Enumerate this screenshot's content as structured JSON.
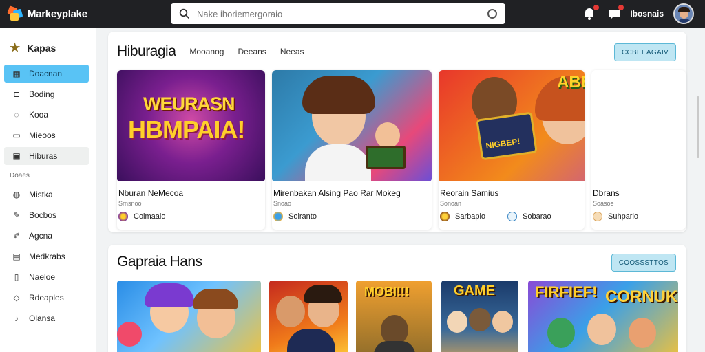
{
  "app": {
    "name": "Markeyplake"
  },
  "search": {
    "placeholder": "Nake ihoriemergoraio"
  },
  "user": {
    "name": "Ibosnais"
  },
  "sidebar": {
    "header": "Kapas",
    "items": [
      {
        "label": "Doacnan",
        "icon": "grid-icon",
        "state": "active"
      },
      {
        "label": "Boding",
        "icon": "bookmark-icon"
      },
      {
        "label": "Kooa",
        "icon": "chat-icon"
      },
      {
        "label": "Mieoos",
        "icon": "monitor-icon"
      },
      {
        "label": "Hiburas",
        "icon": "gamepad-icon",
        "state": "highlight"
      }
    ],
    "section_label": "Doaes",
    "section_items": [
      {
        "label": "Mistka",
        "icon": "headset-icon"
      },
      {
        "label": "Bocbos",
        "icon": "pencil-icon"
      },
      {
        "label": "Agcna",
        "icon": "pen-icon"
      },
      {
        "label": "Medkrabs",
        "icon": "message-icon"
      },
      {
        "label": "Naeloe",
        "icon": "document-icon"
      },
      {
        "label": "Rdeaples",
        "icon": "tag-icon"
      },
      {
        "label": "Olansa",
        "icon": "music-icon"
      }
    ]
  },
  "section1": {
    "title": "Hiburagia",
    "tabs": [
      "Mooanog",
      "Deeans",
      "Neeas"
    ],
    "button": "CCBEEAGAIV",
    "cards": [
      {
        "title": "Nburan NeMecoa",
        "subtitle": "Srnsnoo",
        "developer": "Colmaalo",
        "thumb_line1": "WEURASN",
        "thumb_line2": "HBMPAIA!"
      },
      {
        "title": "Mirenbakan Alsing Pao Rar Mokeg",
        "subtitle": "Snoao",
        "developer": "Solranto"
      },
      {
        "title": "Reorain Samius",
        "subtitle": "Sonoan",
        "developer": "Sarbapio",
        "developer2": "Sobarao",
        "thumb_label": "ABBAS GAME",
        "badge": "NIGBEP!"
      },
      {
        "title": "Dbrans",
        "subtitle": "Soasoe",
        "developer": "Suhpario"
      }
    ]
  },
  "section2": {
    "title": "Gapraia Hans",
    "button": "COOSSSTTOS",
    "thumbs": [
      {
        "label": ""
      },
      {
        "label": ""
      },
      {
        "label": "MOBI!!!"
      },
      {
        "label": "GAME"
      },
      {
        "label": "FIRFIEF!",
        "label2": "CORNUK"
      }
    ]
  },
  "colors": {
    "accent": "#59c3f5",
    "topbar": "#202124",
    "button_bg": "#bfe6f3",
    "button_border": "#5cb8d6"
  }
}
